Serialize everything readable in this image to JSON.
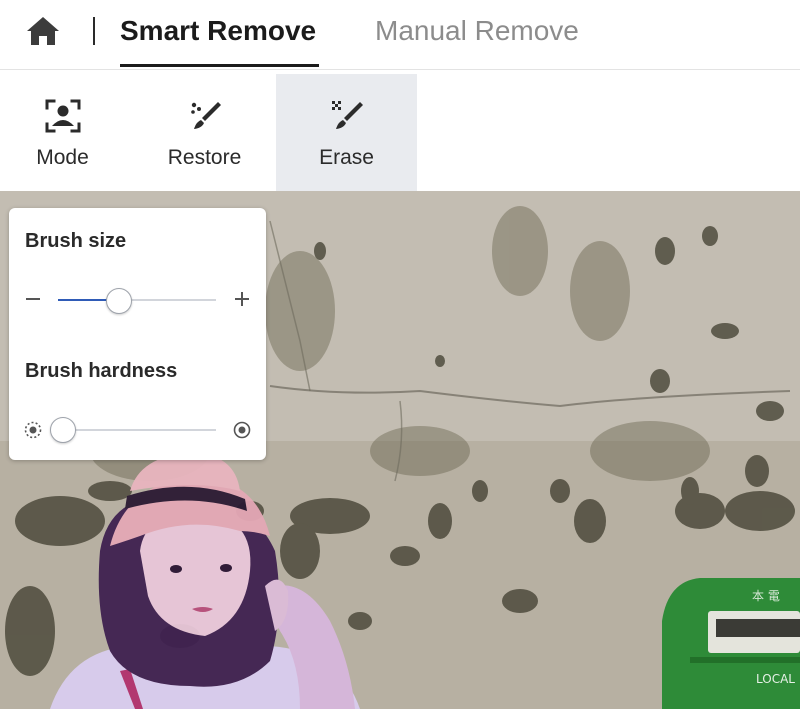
{
  "tabs": {
    "smart_remove": "Smart Remove",
    "manual_remove": "Manual Remove"
  },
  "tools": [
    {
      "label": "Mode",
      "icon": "face-focus-icon"
    },
    {
      "label": "Restore",
      "icon": "restore-brush-icon"
    },
    {
      "label": "Erase",
      "icon": "erase-brush-icon",
      "active": true
    }
  ],
  "panel": {
    "brush_size_label": "Brush size",
    "brush_hardness_label": "Brush hardness",
    "brush_size_value": 0.38,
    "brush_hardness_value": 0.0
  },
  "colors": {
    "active_tool_bg": "#e9ebef",
    "slider_fill": "#2f5bb7",
    "selected_tab": "#1b1b1b",
    "inactive_tab": "#8c8c8c",
    "subject_tint": "#6a3cc0"
  },
  "mailbox_text": {
    "top_chars": "本 電",
    "bottom": "LOCAL"
  }
}
